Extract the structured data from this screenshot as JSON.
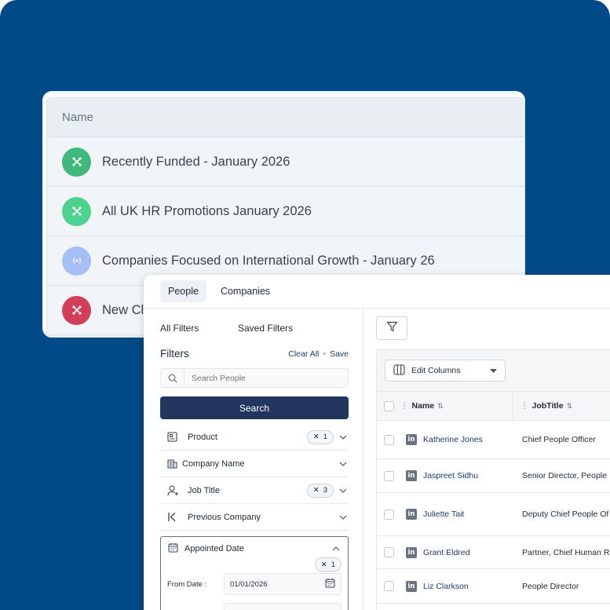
{
  "lists": {
    "header": "Name",
    "rows": [
      {
        "label": "Recently Funded - January 2026",
        "color": "#3fb77d",
        "icon": "connection-icon"
      },
      {
        "label": "All UK HR Promotions January 2026",
        "color": "#4ed08e",
        "icon": "connection-icon"
      },
      {
        "label": "Companies Focused on International Growth - January 26",
        "color": "#a6bff7",
        "icon": "broadcast-icon"
      },
      {
        "label": "New Cl",
        "color": "#d23e5a",
        "icon": "connection-icon"
      }
    ]
  },
  "tabs": [
    "People",
    "Companies"
  ],
  "filters": {
    "all_filters": "All Filters",
    "saved_filters": "Saved Filters",
    "title": "Filters",
    "clear_all": "Clear All",
    "save": "Save",
    "search_placeholder": "Search People",
    "search_button": "Search",
    "facets": [
      {
        "name": "Product",
        "chip": "1",
        "icon": "product-icon"
      },
      {
        "name": "Company Name",
        "chip": "",
        "icon": "building-icon"
      },
      {
        "name": "Job Title",
        "chip": "3",
        "icon": "add-person-icon"
      },
      {
        "name": "Previous Company",
        "chip": "",
        "icon": "previous-icon"
      }
    ],
    "appointed": {
      "name": "Appointed Date",
      "chip": "1",
      "from_label": "From Date :",
      "from_value": "01/01/2026"
    }
  },
  "grid": {
    "edit_columns": "Edit Columns",
    "columns": [
      "Name",
      "JobTitle"
    ],
    "rows": [
      {
        "name": "Katherine Jones",
        "title": "Chief People Officer"
      },
      {
        "name": "Jaspreet Sidhu",
        "title": "Senior Director, People"
      },
      {
        "name": "Juliette Tait",
        "title": "Deputy Chief People Of"
      },
      {
        "name": "Grant Eldred",
        "title": "Partner, Chief Human R"
      },
      {
        "name": "Liz Clarkson",
        "title": "People Director"
      }
    ]
  }
}
